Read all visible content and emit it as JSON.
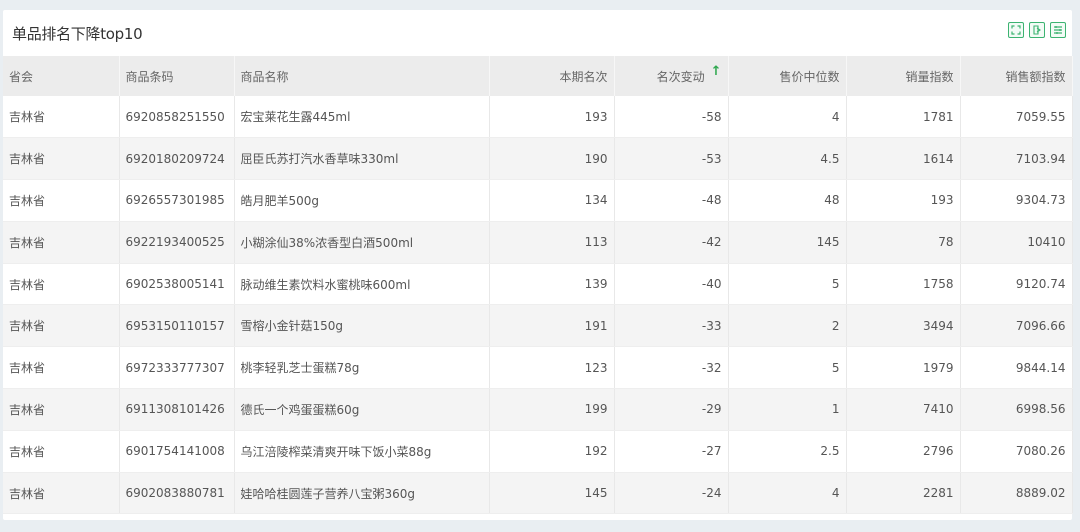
{
  "panel": {
    "title": "单品排名下降top10"
  },
  "toolbar": {
    "icons": [
      "fullscreen-icon",
      "export-icon",
      "list-settings-icon"
    ],
    "accent": "#3cb371"
  },
  "table": {
    "headers": [
      "省会",
      "商品条码",
      "商品名称",
      "本期名次",
      "名次变动",
      "售价中位数",
      "销量指数",
      "销售额指数"
    ],
    "sort_column": "名次变动",
    "sort_direction": "ascending",
    "rows": [
      [
        "吉林省",
        "6920858251550",
        "宏宝莱花生露445ml",
        "193",
        "-58",
        "4",
        "1781",
        "7059.55"
      ],
      [
        "吉林省",
        "6920180209724",
        "屈臣氏苏打汽水香草味330ml",
        "190",
        "-53",
        "4.5",
        "1614",
        "7103.94"
      ],
      [
        "吉林省",
        "6926557301985",
        "皓月肥羊500g",
        "134",
        "-48",
        "48",
        "193",
        "9304.73"
      ],
      [
        "吉林省",
        "6922193400525",
        "小糊涂仙38%浓香型白酒500ml",
        "113",
        "-42",
        "145",
        "78",
        "10410"
      ],
      [
        "吉林省",
        "6902538005141",
        "脉动维生素饮料水蜜桃味600ml",
        "139",
        "-40",
        "5",
        "1758",
        "9120.74"
      ],
      [
        "吉林省",
        "6953150110157",
        "雪榕小金针菇150g",
        "191",
        "-33",
        "2",
        "3494",
        "7096.66"
      ],
      [
        "吉林省",
        "6972333777307",
        "桃李轻乳芝士蛋糕78g",
        "123",
        "-32",
        "5",
        "1979",
        "9844.14"
      ],
      [
        "吉林省",
        "6911308101426",
        "德氏一个鸡蛋蛋糕60g",
        "199",
        "-29",
        "1",
        "7410",
        "6998.56"
      ],
      [
        "吉林省",
        "6901754141008",
        "乌江涪陵榨菜清爽开味下饭小菜88g",
        "192",
        "-27",
        "2.5",
        "2796",
        "7080.26"
      ],
      [
        "吉林省",
        "6902083880781",
        "娃哈哈桂圆莲子营养八宝粥360g",
        "145",
        "-24",
        "4",
        "2281",
        "8889.02"
      ]
    ]
  }
}
